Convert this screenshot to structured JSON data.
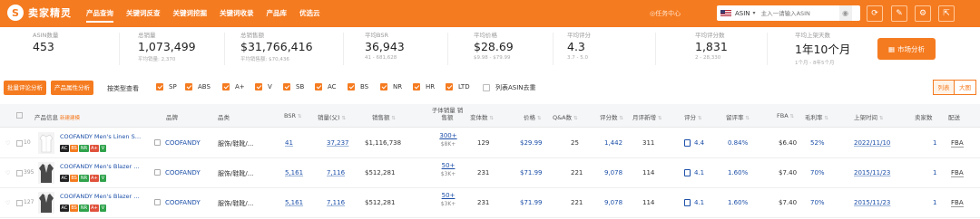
{
  "app": {
    "logo_mark": "S",
    "logo_text": "卖家精灵"
  },
  "nav": [
    {
      "label": "产品查询",
      "active": true
    },
    {
      "label": "关键词反查",
      "active": false
    },
    {
      "label": "关键词挖掘",
      "active": false
    },
    {
      "label": "关键词收录",
      "active": false
    },
    {
      "label": "产品库",
      "active": false
    },
    {
      "label": "优选云",
      "active": false
    }
  ],
  "task_center": "◎任务中心",
  "search": {
    "type": "ASIN",
    "placeholder": "主入一请输入ASIN"
  },
  "stats": [
    {
      "label": "ASIN数量",
      "value": "453",
      "sub": ""
    },
    {
      "label": "总销量",
      "value": "1,073,499",
      "sub": "平均销量: 2,370"
    },
    {
      "label": "总销售额",
      "value": "$31,766,416",
      "sub": "平均销售额: $70,436"
    },
    {
      "label": "平均BSR",
      "value": "36,943",
      "sub": "41 - 681,628"
    },
    {
      "label": "平均价格",
      "value": "$28.69",
      "sub": "$9.98 - $79.99"
    },
    {
      "label": "平均评分",
      "value": "4.3",
      "sub": "3.7 - 5.0"
    },
    {
      "label": "平均评分数",
      "value": "1,831",
      "sub": "2 - 28,330"
    },
    {
      "label": "平均上架天数",
      "value": "1年10个月",
      "sub": "1个月 - 8年5个月"
    }
  ],
  "market_button": "市场分析",
  "filters": {
    "batch_review": "批量评论分析",
    "attr_analysis": "产品属性分析",
    "label": "按类型查看",
    "checks": [
      {
        "label": "SP",
        "on": true
      },
      {
        "label": "ABS",
        "on": true
      },
      {
        "label": "A+",
        "on": true
      },
      {
        "label": "V",
        "on": true
      },
      {
        "label": "SB",
        "on": true
      },
      {
        "label": "AC",
        "on": true
      },
      {
        "label": "BS",
        "on": true
      },
      {
        "label": "NR",
        "on": true
      },
      {
        "label": "HR",
        "on": true
      },
      {
        "label": "LTD",
        "on": true
      },
      {
        "label": "列表ASIN去重",
        "on": false
      }
    ],
    "view_list": "列表",
    "view_big": "大图"
  },
  "columns": {
    "product": "产品信息",
    "product_new": "新建建模",
    "brand": "品牌",
    "category": "品类",
    "bsr": "BSR",
    "sales": "销量(父)",
    "revenue": "销售额",
    "child_sales": "子体销量 销售额",
    "reviews": "变体数",
    "price": "价格",
    "qa": "Q&A数",
    "rating_count": "评分数",
    "monthly_new": "月评新增",
    "rating": "评分",
    "retention": "留评率",
    "fba": "FBA",
    "margin": "毛利率",
    "listed": "上架时间",
    "sellers": "卖家数",
    "ship": "配送"
  },
  "rows": [
    {
      "idx": "10",
      "name": "COOFANDY Men's Linen Shi...",
      "tags": [
        "AC",
        "BS",
        "NR",
        "A+",
        "V"
      ],
      "brand": "COOFANDY",
      "category": "服饰/鞋靴/...",
      "bsr": "41",
      "sales": "37,237",
      "revenue": "$1,116,738",
      "child_sales": "300+",
      "child_rev": "$8K+",
      "variants": "129",
      "price": "$29.99",
      "qa": "25",
      "rating_count": "1,442",
      "monthly_new": "311",
      "rating": "4.4",
      "retention": "0.84%",
      "fba": "$6.40",
      "margin": "52%",
      "listed": "2022/11/10",
      "sellers": "1",
      "ship": "FBA"
    },
    {
      "idx": "395",
      "name": "COOFANDY Men's Blazer Ca...",
      "tags": [
        "AC",
        "BS",
        "NR",
        "A+",
        "V"
      ],
      "brand": "COOFANDY",
      "category": "服饰/鞋靴/...",
      "bsr": "5,161",
      "sales": "7,116",
      "revenue": "$512,281",
      "child_sales": "50+",
      "child_rev": "$3K+",
      "variants": "231",
      "price": "$71.99",
      "qa": "221",
      "rating_count": "9,078",
      "monthly_new": "114",
      "rating": "4.1",
      "retention": "1.60%",
      "fba": "$7.40",
      "margin": "70%",
      "listed": "2015/11/23",
      "sellers": "1",
      "ship": "FBA"
    },
    {
      "idx": "127",
      "name": "COOFANDY Men's Blazer Ca...",
      "tags": [
        "AC",
        "BS",
        "NR",
        "A+",
        "V"
      ],
      "brand": "COOFANDY",
      "category": "服饰/鞋靴/...",
      "bsr": "5,161",
      "sales": "7,116",
      "revenue": "$512,281",
      "child_sales": "50+",
      "child_rev": "$3K+",
      "variants": "231",
      "price": "$71.99",
      "qa": "221",
      "rating_count": "9,078",
      "monthly_new": "114",
      "rating": "4.1",
      "retention": "1.60%",
      "fba": "$7.40",
      "margin": "70%",
      "listed": "2015/11/23",
      "sellers": "1",
      "ship": "FBA"
    }
  ]
}
